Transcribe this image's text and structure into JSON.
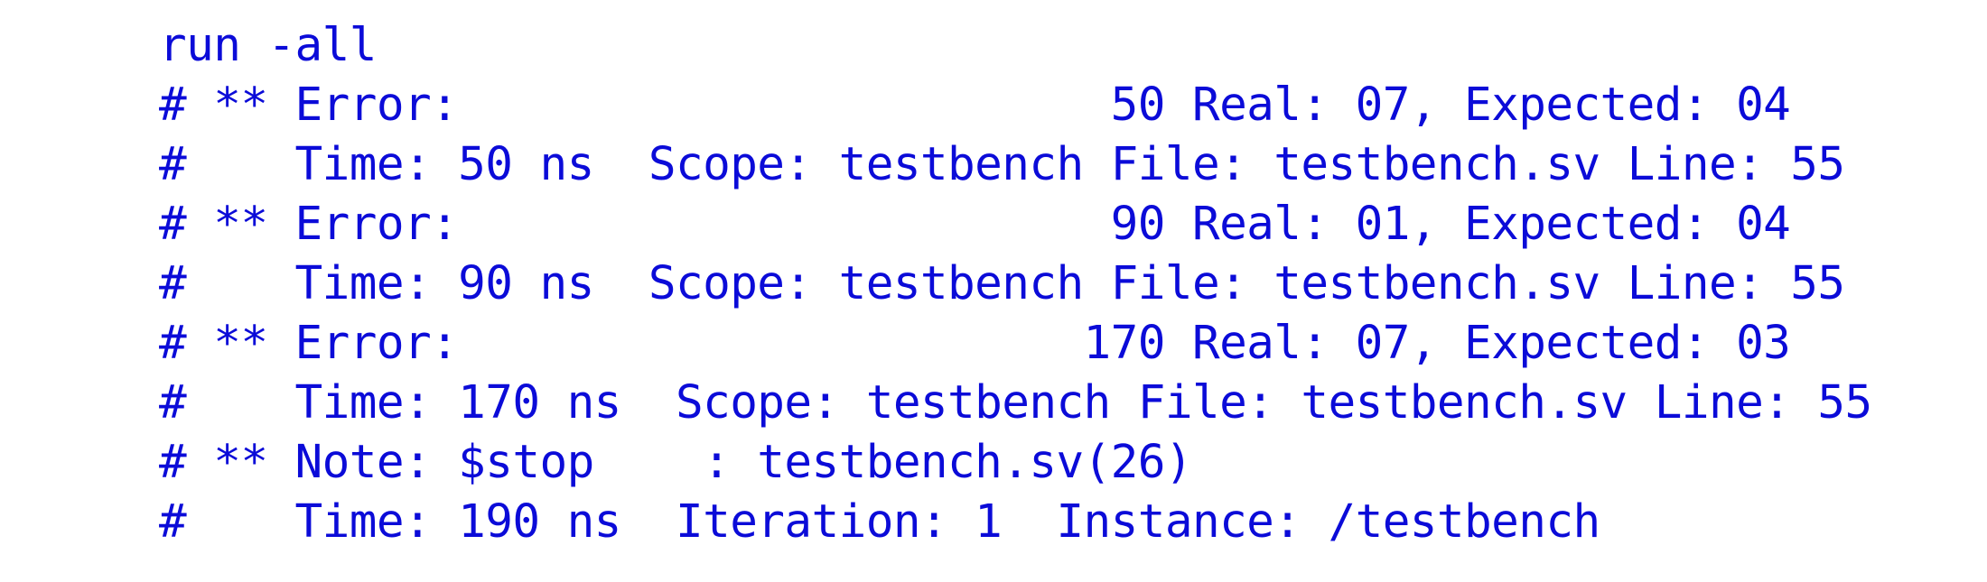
{
  "transcript": {
    "lines": [
      "run -all",
      "# ** Error:                        50 Real: 07, Expected: 04",
      "#    Time: 50 ns  Scope: testbench File: testbench.sv Line: 55",
      "# ** Error:                        90 Real: 01, Expected: 04",
      "#    Time: 90 ns  Scope: testbench File: testbench.sv Line: 55",
      "# ** Error:                       170 Real: 07, Expected: 03",
      "#    Time: 170 ns  Scope: testbench File: testbench.sv Line: 55",
      "# ** Note: $stop    : testbench.sv(26)",
      "#    Time: 190 ns  Iteration: 1  Instance: /testbench"
    ]
  },
  "colors": {
    "text": "#0b0bd8",
    "background": "#ffffff"
  }
}
